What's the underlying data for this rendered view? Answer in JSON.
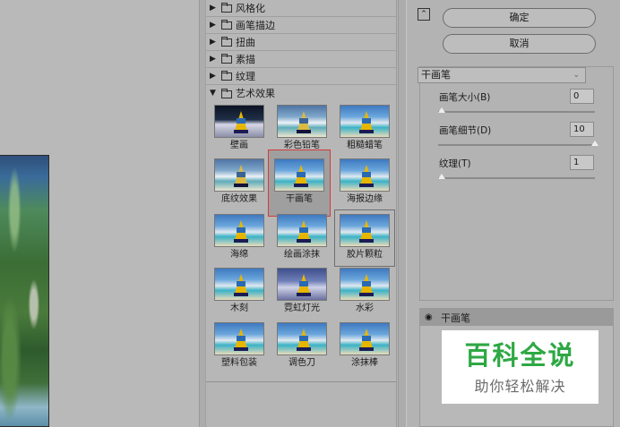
{
  "categories": [
    {
      "label": "风格化",
      "expanded": false
    },
    {
      "label": "画笔描边",
      "expanded": false
    },
    {
      "label": "扭曲",
      "expanded": false
    },
    {
      "label": "素描",
      "expanded": false
    },
    {
      "label": "纹理",
      "expanded": false
    },
    {
      "label": "艺术效果",
      "expanded": true
    }
  ],
  "filters": [
    "壁画",
    "彩色铅笔",
    "粗糙蜡笔",
    "底纹效果",
    "干画笔",
    "海报边缘",
    "海绵",
    "绘画涂抹",
    "胶片颗粒",
    "木刻",
    "霓虹灯光",
    "水彩",
    "塑料包装",
    "调色刀",
    "涂抹棒"
  ],
  "selected_filter": "干画笔",
  "buttons": {
    "ok": "确定",
    "cancel": "取消",
    "collapse_glyph": "⌃"
  },
  "settings": {
    "filter_name": "干画笔",
    "params": [
      {
        "label": "画笔大小(B)",
        "value": "0",
        "level": 0
      },
      {
        "label": "画笔细节(D)",
        "value": "10",
        "level": 1
      },
      {
        "label": "纹理(T)",
        "value": "1",
        "level": 0
      }
    ]
  },
  "layer": {
    "name": "干画笔"
  },
  "watermark": {
    "title": "百科全说",
    "subtitle": "助你轻松解决"
  },
  "glyphs": {
    "expanded": "▼",
    "collapsed": "▶",
    "dropdown": "⌄",
    "eye": "◉"
  }
}
